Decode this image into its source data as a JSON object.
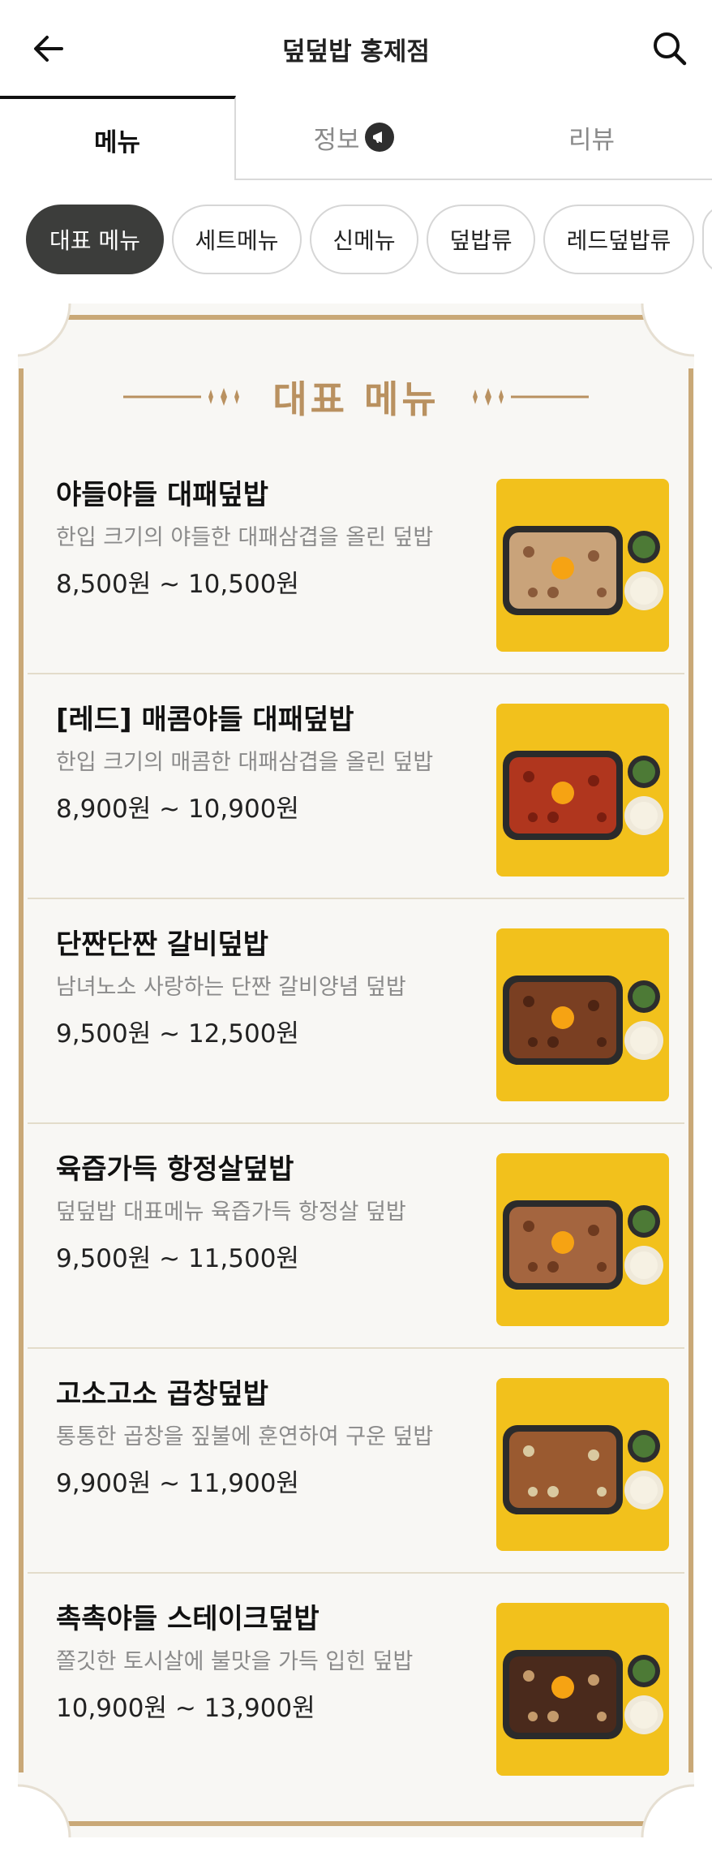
{
  "header": {
    "title": "덮덮밥 홍제점",
    "back_icon": "arrow-left-icon",
    "search_icon": "search-icon"
  },
  "tabs": [
    {
      "label": "메뉴",
      "active": true
    },
    {
      "label": "정보",
      "active": false,
      "icon": "megaphone-icon"
    },
    {
      "label": "리뷰",
      "active": false
    }
  ],
  "chips": [
    {
      "label": "대표 메뉴",
      "active": true
    },
    {
      "label": "세트메뉴",
      "active": false
    },
    {
      "label": "신메뉴",
      "active": false
    },
    {
      "label": "덮밥류",
      "active": false
    },
    {
      "label": "레드덮밥류",
      "active": false
    }
  ],
  "section": {
    "title": "대표 메뉴",
    "accent_color": "#b99160"
  },
  "items": [
    {
      "name": "야들야들 대패덮밥",
      "desc": "한입 크기의 야들한 대패삼겹을 올린 덮밥",
      "price": "8,500원 ~ 10,500원",
      "image": "food-image"
    },
    {
      "name": "[레드] 매콤야들 대패덮밥",
      "desc": "한입 크기의 매콤한 대패삼겹을 올린 덮밥",
      "price": "8,900원 ~ 10,900원",
      "image": "food-image"
    },
    {
      "name": "단짠단짠 갈비덮밥",
      "desc": "남녀노소 사랑하는 단짠 갈비양념 덮밥",
      "price": "9,500원 ~ 12,500원",
      "image": "food-image"
    },
    {
      "name": "육즙가득 항정살덮밥",
      "desc": "덮덮밥 대표메뉴 육즙가득 항정살 덮밥",
      "price": "9,500원 ~ 11,500원",
      "image": "food-image"
    },
    {
      "name": "고소고소 곱창덮밥",
      "desc": "통통한 곱창을 짚불에 훈연하여 구운 덮밥",
      "price": "9,900원 ~ 11,900원",
      "image": "food-image"
    },
    {
      "name": "촉촉야들 스테이크덮밥",
      "desc": "쫄깃한 토시살에 불맛을 가득 입힌 덮밥",
      "price": "10,900원 ~ 13,900원",
      "image": "food-image"
    }
  ]
}
